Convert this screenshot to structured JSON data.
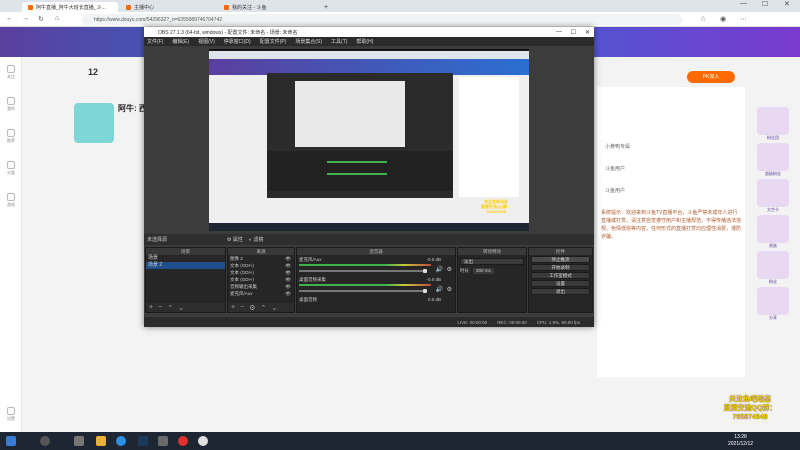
{
  "browser": {
    "tabs": [
      {
        "label": "阿牛直播_阿牛大班长直播_斗..."
      },
      {
        "label": "主播中心"
      },
      {
        "label": "我的关注 - 斗鱼"
      }
    ],
    "new_tab": "+",
    "url": "https://www.douyu.com/5429632?_n=6355089746704742"
  },
  "page": {
    "follow_count": "12",
    "streamer_name": "阿牛: 西",
    "rail_items": [
      "关注",
      "我的",
      "推荐",
      "分类",
      "游戏",
      "设置"
    ],
    "pk_badge": "PK加入",
    "chat_text": "系统提示：欢迎来到斗鱼TV直播平台，斗鱼严禁未成年人进行直播或打赏，请注意自觉遵守用户和主播规范，不得传播违法违规、色情低俗等内容，任何形式的直播打赏均应理性消费，谨防诈骗。",
    "fan_rows": [
      "小黄鸭专属",
      "斗鱼用户",
      "斗鱼用户"
    ],
    "gift_labels": [
      "粉丝团",
      "超级粉丝",
      "太空卡",
      "贵族",
      "粉丝",
      "分享"
    ]
  },
  "obs": {
    "title": "OBS 27.1.3 (64-bit, windows) - 配置文件: 未命名 - 场景: 未命名",
    "menu": [
      "文件(F)",
      "编辑(E)",
      "视图(V)",
      "停靠窗口(D)",
      "配置文件(P)",
      "场景集合(S)",
      "工具(T)",
      "帮助(H)"
    ],
    "scene_bar_label": "未选择源",
    "scene_bar_buttons": [
      "属性",
      "滤镜"
    ],
    "docks": {
      "scenes": {
        "title": "场景",
        "items": [
          "场景",
          "场景 2"
        ]
      },
      "sources": {
        "title": "来源",
        "items": [
          "图像 2",
          "文本 (GDI+)",
          "文本 (GDI+)",
          "文本 (GDI+)",
          "音频输出采集",
          "麦克风/Aux"
        ]
      },
      "mixer": {
        "title": "混音器",
        "channels": [
          {
            "name": "麦克风/Aux",
            "db": "-0.0 dB"
          },
          {
            "name": "桌面音频采集",
            "db": "-0.0 dB"
          },
          {
            "name": "桌面音频",
            "db": "0.0 dB"
          }
        ]
      },
      "transitions": {
        "title": "转场特效",
        "type": "淡出",
        "duration_label": "时长",
        "duration": "300 ms"
      },
      "controls": {
        "title": "控件",
        "buttons": [
          "停止推流",
          "开始录制",
          "工作室模式",
          "设置",
          "退出"
        ]
      }
    },
    "status": {
      "live": "LIVE: 00:00:00",
      "rec": "REC: 00:00:00",
      "cpu": "CPU: 1.9%, 60.00 fps"
    }
  },
  "overlay": {
    "lines": [
      "关注鱼吧动态",
      "直播交流QQ群：",
      "765874548"
    ]
  },
  "taskbar": {
    "time": "13:28",
    "date": "2021/12/12"
  },
  "colors": {
    "accent": "#ff6a00",
    "overlay_text": "#ffd100"
  }
}
